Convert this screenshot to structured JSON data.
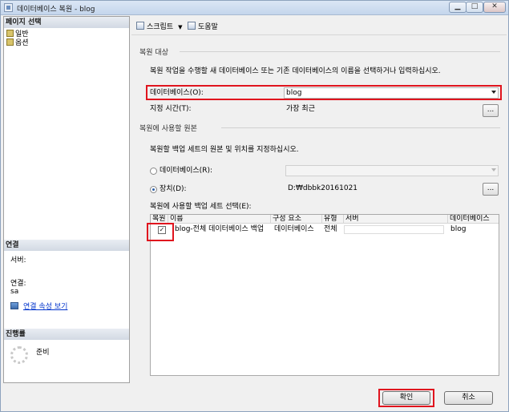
{
  "window": {
    "title": "데이터베이스 복원 - blog",
    "min_glyph": "▁",
    "max_glyph": "□",
    "close_glyph": "✕"
  },
  "left": {
    "page_select_header": "페이지 선택",
    "pages": [
      "일반",
      "옵션"
    ],
    "connection_header": "연결",
    "server_label": "서버:",
    "server_value": "",
    "conn_label": "연결:",
    "conn_value": "sa",
    "view_conn_props": "연결 속성 보기",
    "progress_header": "진행률",
    "progress_status": "준비"
  },
  "toolbar": {
    "script": "스크립트",
    "script_arrow": "▼",
    "help": "도움말"
  },
  "restore_target": {
    "group": "복원 대상",
    "description": "복원 작업을 수행할 새 데이터베이스 또는 기존 데이터베이스의 이름을 선택하거나 입력하십시오.",
    "db_label": "데이터베이스(O):",
    "db_value": "blog",
    "point_label": "지정 시간(T):",
    "point_value": "가장 최근",
    "ellipsis": "..."
  },
  "restore_source": {
    "group": "복원에 사용할 원본",
    "description": "복원할 백업 세트의 원본 및 위치를 지정하십시오.",
    "from_db_label": "데이터베이스(R):",
    "from_device_label": "장치(D):",
    "device_value": "D:₩dbbk20161021",
    "ellipsis": "..."
  },
  "backup_sets": {
    "label": "복원에 사용할 백업 세트 선택(E):",
    "columns": [
      "복원",
      "이름",
      "구성 요소",
      "유형",
      "서버",
      "데이터베이스"
    ],
    "rows": [
      {
        "checked": "✓",
        "name": "blog-전체 데이터베이스 백업",
        "component": "데이터베이스",
        "type": "전체",
        "server": "",
        "database": "blog"
      }
    ]
  },
  "buttons": {
    "ok": "확인",
    "cancel": "취소"
  },
  "colors": {
    "highlight": "#e0141e",
    "link": "#0033cc"
  }
}
